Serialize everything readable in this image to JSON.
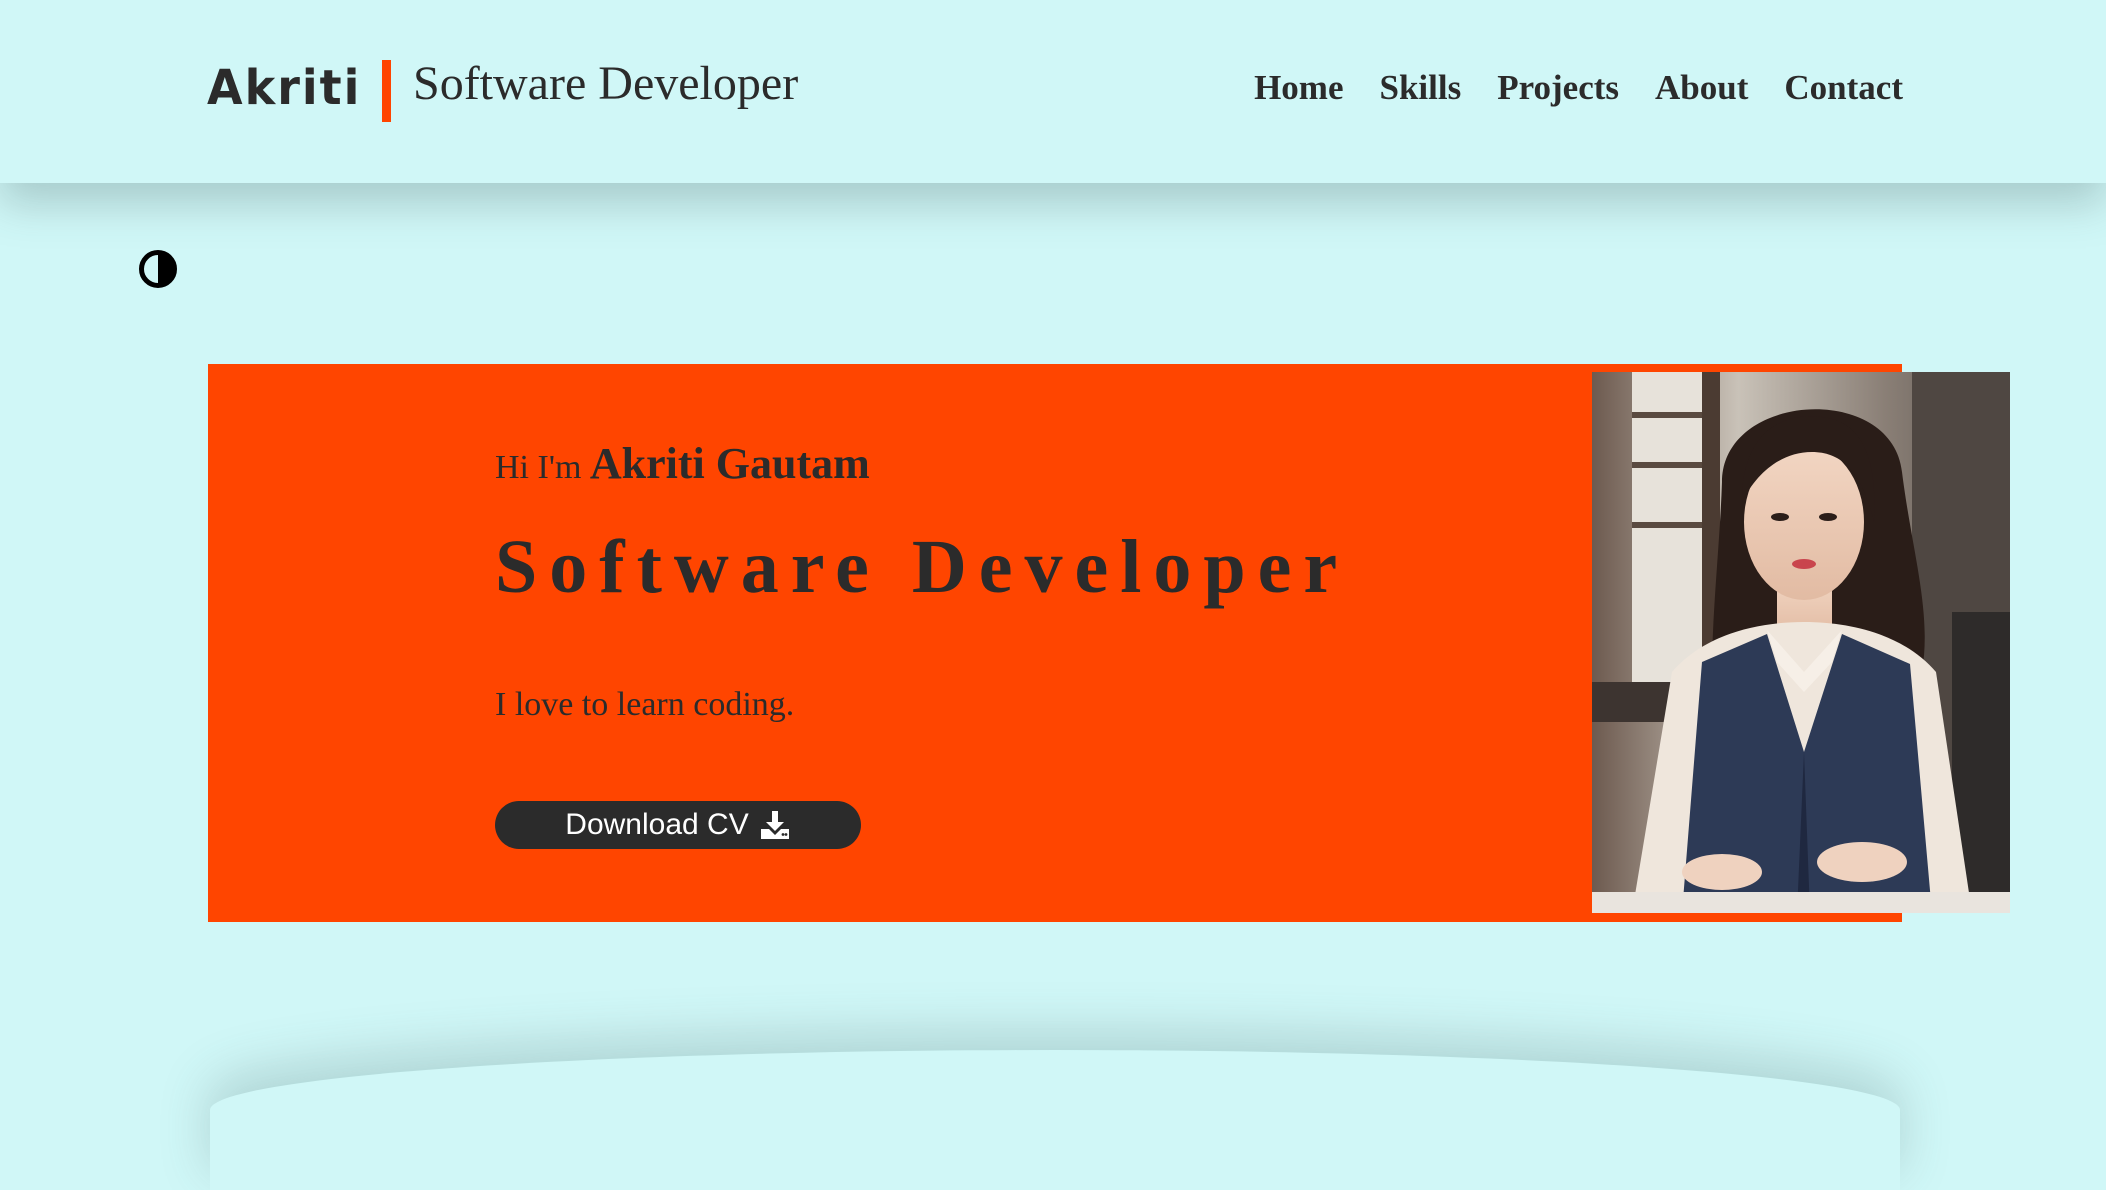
{
  "header": {
    "logo": "Akriti",
    "role": "Software Developer",
    "nav": [
      "Home",
      "Skills",
      "Projects",
      "About",
      "Contact"
    ]
  },
  "hero": {
    "greeting_prefix": "Hi I'm",
    "name": "Akriti Gautam",
    "title": "Software Developer",
    "tagline": "I love to learn coding.",
    "download_label": "Download CV"
  },
  "icons": {
    "theme": "contrast-icon",
    "download": "download-icon"
  },
  "colors": {
    "background": "#d0f7f7",
    "accent": "#ff4500",
    "text": "#2b2b2b",
    "button": "#2b2b2b"
  }
}
